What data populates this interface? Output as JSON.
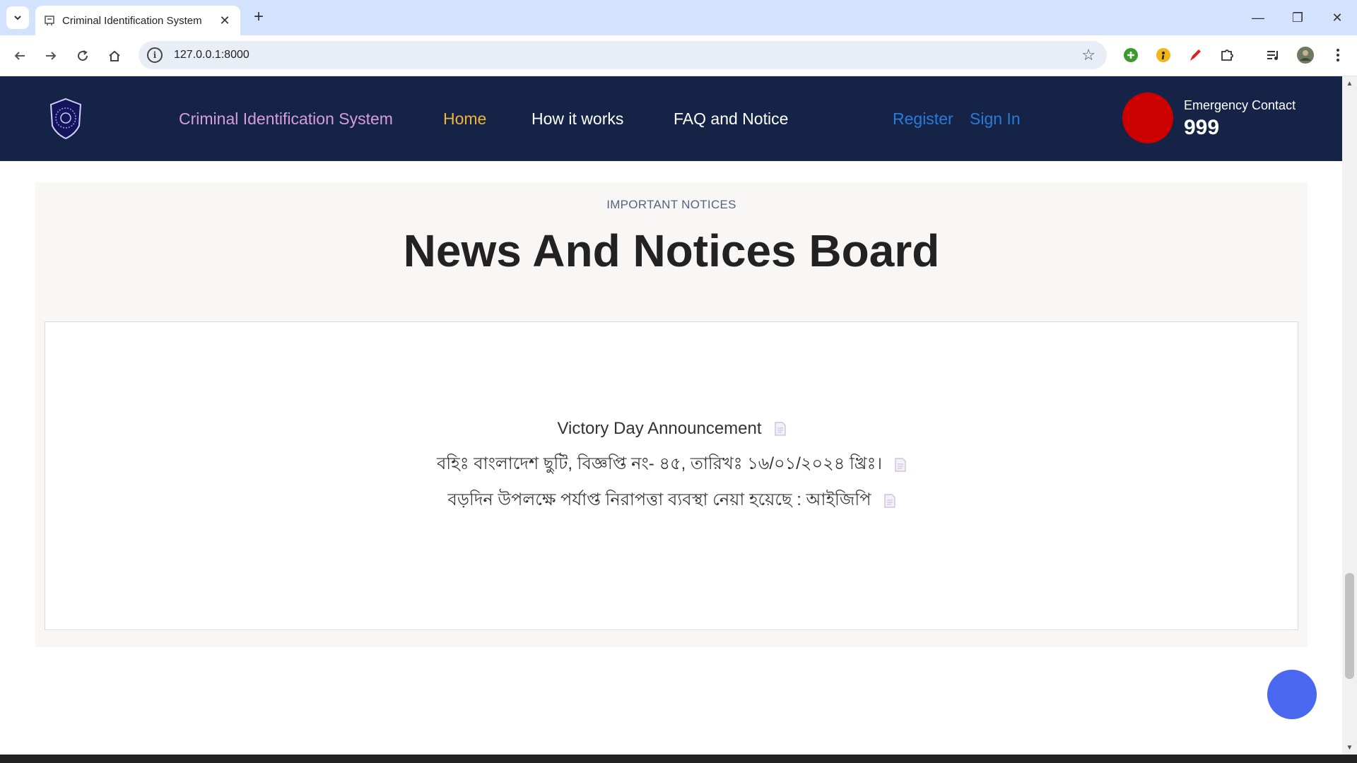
{
  "browser": {
    "tab_title": "Criminal Identification System",
    "url": "127.0.0.1:8000"
  },
  "site": {
    "brand": "Criminal Identification System",
    "nav": [
      "Home",
      "How it works",
      "FAQ and Notice"
    ],
    "register": "Register",
    "sign_in": "Sign In",
    "emergency_label": "Emergency Contact",
    "emergency_number": "999"
  },
  "notices": {
    "eyebrow": "IMPORTANT NOTICES",
    "title": "News And Notices Board",
    "items": [
      "Victory Day Announcement",
      "বহিঃ বাংলাদেশ ছুটি, বিজ্ঞপ্তি নং- ৪৫, তারিখঃ ১৬/০১/২০২৪ খ্রিঃ।",
      "বড়দিন উপলক্ষে পর্যাপ্ত নিরাপত্তা ব্যবস্থা নেয়া হয়েছে : আইজিপি"
    ]
  },
  "colors": {
    "header_bg": "#142346",
    "brand": "#d79cdc",
    "active_nav": "#f0b43a",
    "auth_link": "#2a7bd9",
    "emergency": "#cc0000",
    "fab": "#4a67f0"
  }
}
